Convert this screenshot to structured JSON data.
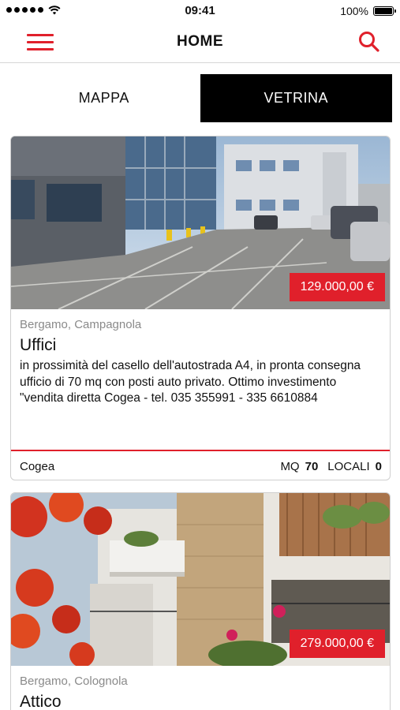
{
  "status_bar": {
    "time": "09:41",
    "battery": "100%"
  },
  "header": {
    "title": "HOME",
    "menu_icon": "hamburger-menu-icon",
    "search_icon": "search-icon"
  },
  "tabs": [
    {
      "label": "MAPPA",
      "active": false
    },
    {
      "label": "VETRINA",
      "active": true
    }
  ],
  "listings": [
    {
      "price": "129.000,00 €",
      "location": "Bergamo, Campagnola",
      "title": "Uffici",
      "description": "in prossimità del casello dell'autostrada A4, in pronta consegna ufficio di 70 mq con posti auto privato. Ottimo investimento \"vendita diretta Cogea - tel. 035 355991 - 335 6610884",
      "agency": "Cogea",
      "mq_label": "MQ",
      "mq_value": "70",
      "locali_label": "LOCALI",
      "locali_value": "0"
    },
    {
      "price": "279.000,00 €",
      "location": "Bergamo, Colognola",
      "title": "Attico"
    }
  ],
  "colors": {
    "accent": "#e0202b",
    "active_tab_bg": "#000000"
  }
}
